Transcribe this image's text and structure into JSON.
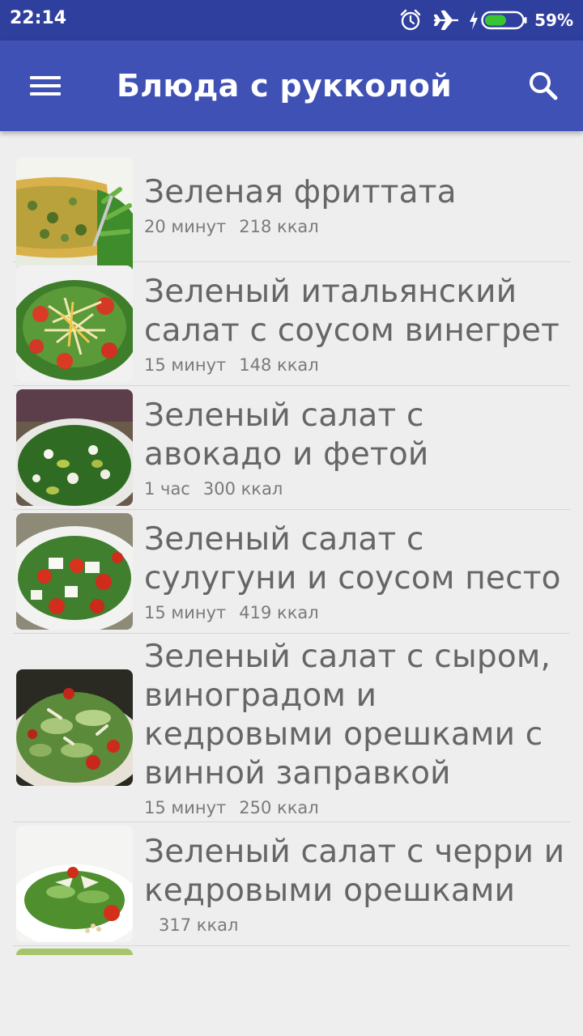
{
  "status_bar": {
    "time": "22:14",
    "battery_percent": "59%",
    "battery_level": 0.59,
    "icons": [
      "alarm-icon",
      "airplane-mode-icon",
      "charging-icon",
      "battery-icon"
    ]
  },
  "app_bar": {
    "title": "Блюда с рукколой",
    "color": "#3f51b5",
    "menu_icon": "hamburger-menu-icon",
    "search_icon": "search-icon"
  },
  "recipes": [
    {
      "title": "Зеленая фриттата",
      "time": "20 минут",
      "kcal": "218 ккал",
      "image": "frittata"
    },
    {
      "title": "Зеленый итальянский салат с соусом винегрет",
      "time": "15 минут",
      "kcal": "148 ккал",
      "image": "italian-salad"
    },
    {
      "title": "Зеленый салат с авокадо и фетой",
      "time": "1 час",
      "kcal": "300 ккал",
      "image": "avocado-feta-salad"
    },
    {
      "title": "Зеленый салат с сулугуни и соусом песто",
      "time": "15 минут",
      "kcal": "419 ккал",
      "image": "suluguni-pesto-salad"
    },
    {
      "title": "Зеленый салат с сыром, виноградом и кедровыми орешками с винной заправкой",
      "time": "15 минут",
      "kcal": "250 ккал",
      "image": "cheese-grape-salad"
    },
    {
      "title": "Зеленый салат с черри и кедровыми орешками",
      "time": "",
      "kcal": "317 ккал",
      "image": "cherry-pine-nut-salad"
    }
  ]
}
